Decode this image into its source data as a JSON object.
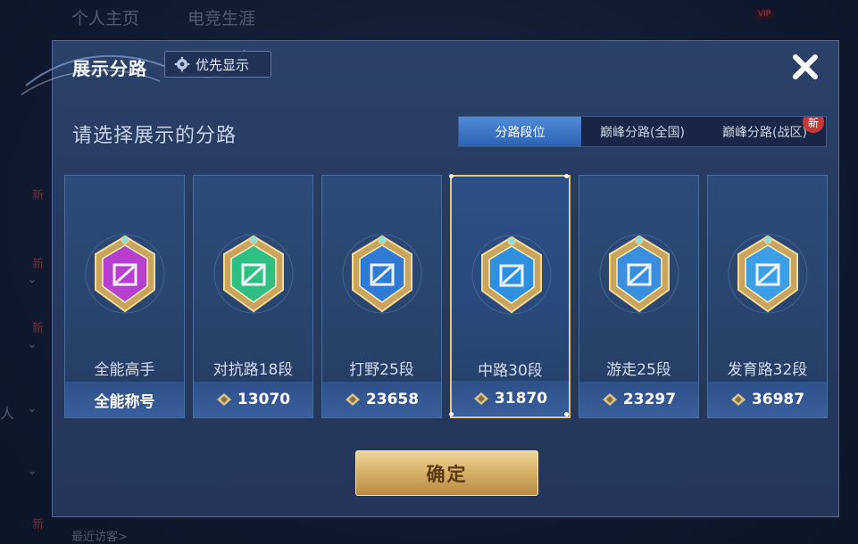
{
  "background": {
    "tabs": [
      "个人主页",
      "电竞生涯"
    ],
    "vip": "VIP",
    "new_badge": "新",
    "side_char": "人",
    "recent": "最近访客>"
  },
  "dialog": {
    "title": "展示分路",
    "priority_label": "优先显示",
    "subtitle": "请选择展示的分路",
    "tabs": [
      {
        "label": "分路段位",
        "active": true
      },
      {
        "label": "巅峰分路(全国)",
        "active": false
      },
      {
        "label": "巅峰分路(战区)",
        "active": false,
        "badge": "新"
      }
    ],
    "cards": [
      {
        "label": "全能高手",
        "value": "全能称号",
        "show_icon": false,
        "emblem_color": "#b63fd0",
        "icon": "allround-emblem-icon"
      },
      {
        "label": "对抗路18段",
        "value": "13070",
        "show_icon": true,
        "emblem_color": "#2fbf85",
        "icon": "clash-lane-emblem-icon"
      },
      {
        "label": "打野25段",
        "value": "23658",
        "show_icon": true,
        "emblem_color": "#2e7ad6",
        "icon": "jungle-emblem-icon"
      },
      {
        "label": "中路30段",
        "value": "31870",
        "show_icon": true,
        "emblem_color": "#2f8fe0",
        "icon": "mid-lane-emblem-icon",
        "selected": true
      },
      {
        "label": "游走25段",
        "value": "23297",
        "show_icon": true,
        "emblem_color": "#3a8ee0",
        "icon": "roam-emblem-icon"
      },
      {
        "label": "发育路32段",
        "value": "36987",
        "show_icon": true,
        "emblem_color": "#3a9ee8",
        "icon": "farm-lane-emblem-icon"
      }
    ],
    "confirm_label": "确定"
  },
  "colors": {
    "gold": "#e5c887",
    "tab_active": "#3b74c7"
  }
}
